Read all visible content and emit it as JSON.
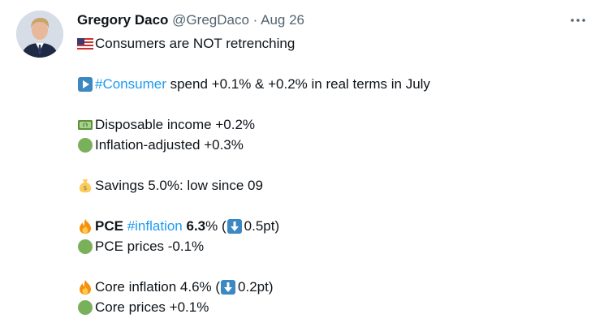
{
  "tweet": {
    "author_name": "Gregory Daco",
    "handle": "@GregDaco",
    "separator": "·",
    "date": "Aug 26",
    "lines": {
      "l1": "Consumers are NOT retrenching",
      "l2_hashtag": "#Consumer",
      "l2_rest": " spend +0.1% & +0.2% in real terms in July",
      "l3": "Disposable income +0.2%",
      "l4": "Inflation-adjusted +0.3%",
      "l5": "Savings 5.0%: low since 09",
      "l6_pce": "PCE",
      "l6_hashtag": "#inflation",
      "l6_value": "6.3",
      "l6_pct": "% (",
      "l6_change": "0.5pt)",
      "l7": "PCE prices -0.1%",
      "l8_text": "Core inflation 4.6% (",
      "l8_change": "0.2pt)",
      "l9": "Core prices +0.1%"
    }
  },
  "icons": {
    "more": "more-icon",
    "flag": "us-flag-icon",
    "play": "play-button-icon",
    "money": "dollar-banknote-icon",
    "circle": "green-circle-icon",
    "moneybag": "money-bag-icon",
    "fire": "fire-icon",
    "down": "down-arrow-icon"
  },
  "colors": {
    "link": "#1d9bf0",
    "text": "#0f1419",
    "muted": "#536471"
  }
}
